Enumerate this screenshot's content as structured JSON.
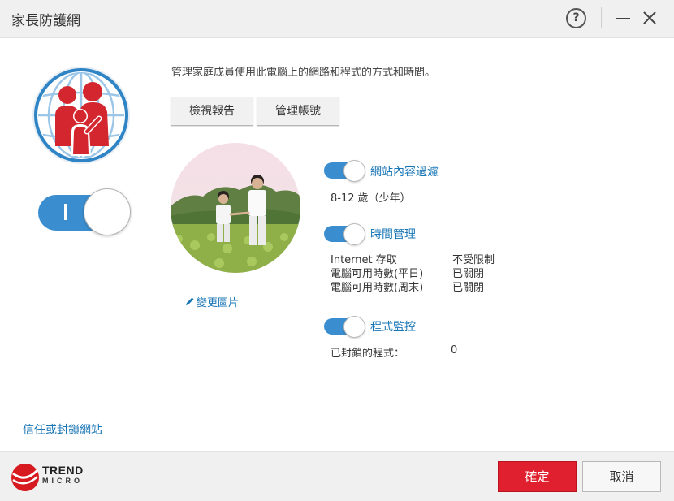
{
  "window": {
    "title": "家長防護網",
    "help_label": "?",
    "minimize_icon": "minimize-icon",
    "close_icon": "close-icon"
  },
  "colors": {
    "accent": "#3a8ed0",
    "link": "#1976b6",
    "primary_button": "#e0202e",
    "brand_red": "#d71920"
  },
  "main_toggle": {
    "state": "on",
    "on_label": "I"
  },
  "header": {
    "description": "管理家庭成員使用此電腦上的網路和程式的方式和時間。"
  },
  "toolbar": {
    "view_report_label": "檢視報告",
    "manage_account_label": "管理帳號"
  },
  "profile": {
    "change_photo_label": "變更圖片",
    "change_photo_icon": "pencil-icon"
  },
  "features": {
    "web_filter": {
      "label": "網站內容過濾",
      "enabled": true,
      "age_setting": "8-12 歲（少年）"
    },
    "time_management": {
      "label": "時間管理",
      "enabled": true,
      "rows": [
        {
          "name": "Internet 存取",
          "value": "不受限制"
        },
        {
          "name": "電腦可用時數(平日)",
          "value": "已關閉"
        },
        {
          "name": "電腦可用時數(周末)",
          "value": "已關閉"
        }
      ]
    },
    "program_control": {
      "label": "程式監控",
      "enabled": true,
      "blocked_label": "已封鎖的程式：",
      "blocked_count": "0"
    }
  },
  "links": {
    "trust_block_sites": "信任或封鎖網站"
  },
  "footer": {
    "brand_line1": "TREND",
    "brand_line2": "MICRO",
    "ok_label": "確定",
    "cancel_label": "取消"
  }
}
